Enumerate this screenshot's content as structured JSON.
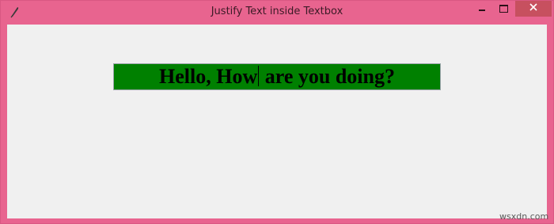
{
  "window": {
    "title": "Justify Text inside Textbox",
    "icon": "feather-icon",
    "controls": [
      "minimize-icon",
      "maximize-icon",
      "close-icon"
    ],
    "frame_color": "#e8648f",
    "close_color": "#c7505f"
  },
  "textbox": {
    "text_before_caret": "Hello, How",
    "text_after_caret": " are you doing?",
    "background_color": "#008000",
    "text_color": "#000000"
  },
  "watermark": "wsxdn.com"
}
